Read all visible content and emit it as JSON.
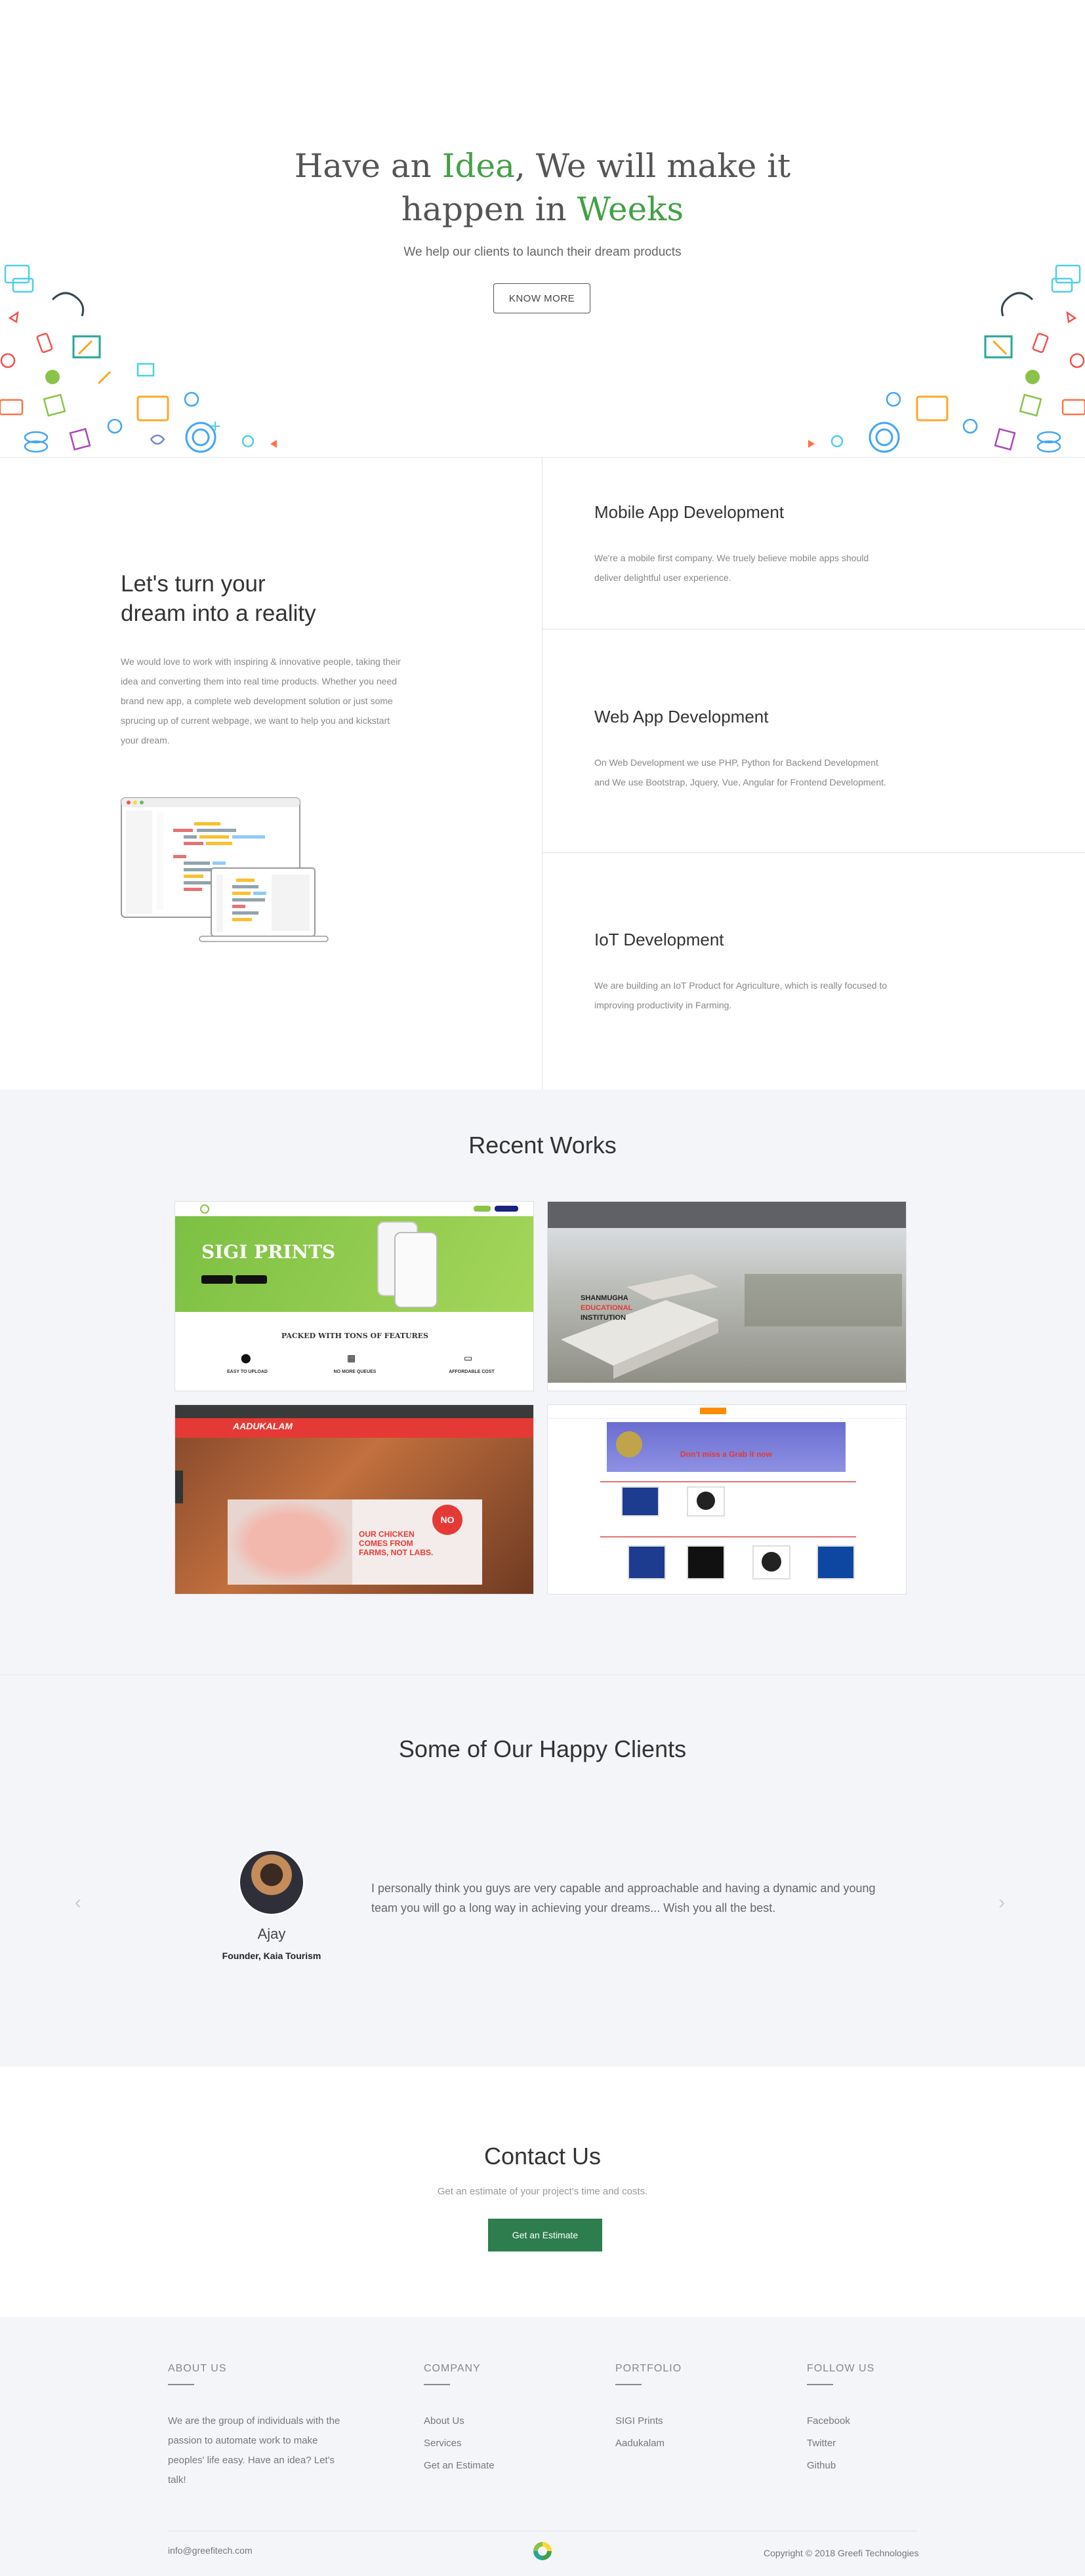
{
  "hero": {
    "title_pre": "Have an ",
    "title_idea": "Idea",
    "title_mid": ", We will make it",
    "title_line2": "happen in ",
    "title_weeks": "Weeks",
    "subtitle": "We help our clients to launch their dream products",
    "button": "KNOW MORE"
  },
  "intro": {
    "title_line1": "Let's turn your",
    "title_line2": "dream into a reality",
    "text": "We would love to work with inspiring & innovative people, taking their idea and converting them into real time products. Whether you need brand new app, a complete web development solution or just some sprucing up of current webpage, we want to help you and kickstart your dream."
  },
  "services": [
    {
      "title": "Mobile App Development",
      "text": "We're a mobile first company. We truely believe mobile apps should deliver delightful user experience."
    },
    {
      "title": "Web App Development",
      "text": "On Web Development we use PHP, Python for Backend Development and We use Bootstrap, Jquery, Vue, Angular for Frontend Development."
    },
    {
      "title": "IoT Development",
      "text": "We are building an IoT Product for Agriculture, which is really focused to improving productivity in Farming."
    }
  ],
  "works": {
    "title": "Recent Works",
    "items": [
      {
        "headline": "SIGI PRINTS",
        "feature_title": "PACKED WITH TONS OF FEATURES",
        "f1": "EASY TO UPLOAD",
        "f2": "NO MORE QUEUES",
        "f3": "AFFORDABLE COST"
      },
      {
        "line1": "SHANMUGHA",
        "line2": "EDUCATIONAL",
        "line3": "INSTITUTION"
      },
      {
        "brand": "AADUKALAM",
        "ad_line1": "OUR CHICKEN",
        "ad_line2": "COMES FROM",
        "ad_line3": "FARMS, NOT LABS.",
        "badge": "NO"
      },
      {
        "promo": "Don't miss a Grab it now"
      }
    ]
  },
  "clients": {
    "title": "Some of Our Happy Clients",
    "name": "Ajay",
    "role": "Founder, Kaia Tourism",
    "quote": "I personally think you guys are very capable and approachable and having a dynamic and young team you will go a long way in achieving your dreams... Wish you all the best.",
    "prev": "‹",
    "next": "›"
  },
  "contact": {
    "title": "Contact Us",
    "subtitle": "Get an estimate of your project's time and costs.",
    "button": "Get an Estimate"
  },
  "footer": {
    "about_head": "ABOUT US",
    "about_text": "We are the group of individuals with the passion to automate work to make peoples' life easy. Have an idea? Let's talk!",
    "company_head": "COMPANY",
    "company_links": [
      "About Us",
      "Services",
      "Get an Estimate"
    ],
    "portfolio_head": "PORTFOLIO",
    "portfolio_links": [
      "SIGI Prints",
      "Aadukalam"
    ],
    "follow_head": "FOLLOW US",
    "follow_links": [
      "Facebook",
      "Twitter",
      "Github"
    ],
    "email": "info@greefitech.com",
    "copyright": "Copyright © 2018 Greefi Technologies"
  }
}
